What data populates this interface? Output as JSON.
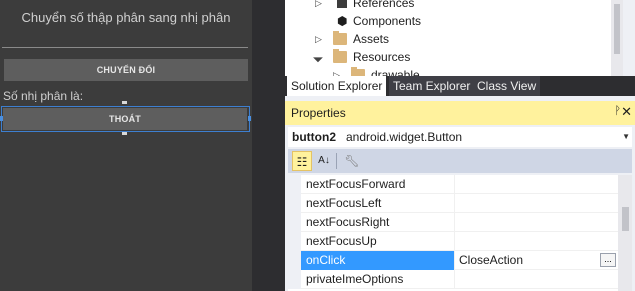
{
  "designer": {
    "title": "Chuyển số thập phân sang nhị phân",
    "convert_button": "CHUYỂN ĐỔI",
    "result_label": "Số nhị phân là:",
    "exit_button": "THOÁT"
  },
  "solution_explorer": {
    "items": [
      {
        "label": "References",
        "icon": "references-icon",
        "expandable": true
      },
      {
        "label": "Components",
        "icon": "components-icon",
        "expandable": false
      },
      {
        "label": "Assets",
        "icon": "folder-icon",
        "expandable": true
      },
      {
        "label": "Resources",
        "icon": "folder-open-icon",
        "expandable": true
      },
      {
        "label": "drawable",
        "icon": "folder-icon",
        "expandable": true
      }
    ]
  },
  "tabs": [
    {
      "label": "Solution Explorer",
      "active": true
    },
    {
      "label": "Team Explorer",
      "active": false
    },
    {
      "label": "Class View",
      "active": false
    }
  ],
  "properties": {
    "title": "Properties",
    "pin": "ᵖ",
    "close": "✕",
    "object_name": "button2",
    "object_type": "android.widget.Button",
    "rows": [
      {
        "name": "nextFocusForward",
        "value": ""
      },
      {
        "name": "nextFocusLeft",
        "value": ""
      },
      {
        "name": "nextFocusRight",
        "value": ""
      },
      {
        "name": "nextFocusUp",
        "value": ""
      },
      {
        "name": "onClick",
        "value": "CloseAction",
        "selected": true
      },
      {
        "name": "privateImeOptions",
        "value": ""
      }
    ],
    "ellipsis": "...",
    "accent_color": "#fff29d",
    "selection_color": "#3399ff"
  }
}
